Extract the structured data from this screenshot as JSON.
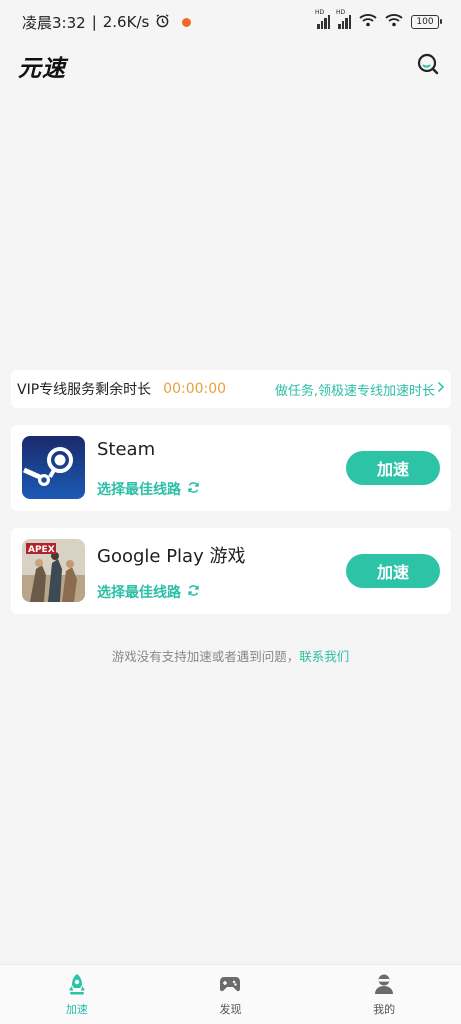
{
  "status_bar": {
    "time": "凌晨3:32",
    "speed": "2.6K/s",
    "battery": "100",
    "signal_label": "HD"
  },
  "header": {
    "logo": "元速",
    "search_icon": "search-icon"
  },
  "vip": {
    "label": "VIP专线服务剩余时长",
    "time": "00:00:00",
    "link": "做任务,领极速专线加速时长"
  },
  "games": [
    {
      "name": "Steam",
      "route_label": "选择最佳线路",
      "button": "加速"
    },
    {
      "name": "Google Play 游戏",
      "route_label": "选择最佳线路",
      "button": "加速",
      "icon_text": "APEX"
    }
  ],
  "help": {
    "text": "游戏没有支持加速或者遇到问题，",
    "link": "联系我们"
  },
  "nav": {
    "items": [
      {
        "label": "加速",
        "icon": "rocket-icon"
      },
      {
        "label": "发现",
        "icon": "gamepad-icon"
      },
      {
        "label": "我的",
        "icon": "user-icon"
      }
    ]
  },
  "colors": {
    "accent": "#2cc3a6",
    "timer": "#e8a23a",
    "background": "#f5f5f5"
  }
}
